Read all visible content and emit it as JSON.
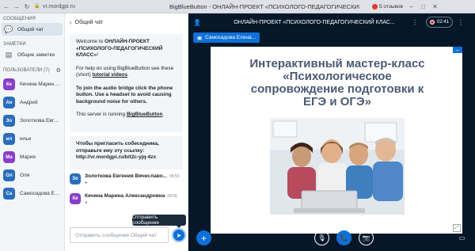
{
  "browser": {
    "url": "vr.mordgpi.ru",
    "window_title": "BigBlueButton - ОНЛАЙН-ПРОЕКТ «ПСИХОЛОГО-ПЕДАГОГИЧЕСКИЙ КЛАСС»",
    "badge": "5 отзывов"
  },
  "sidebar": {
    "messages_title": "СООБЩЕНИЯ",
    "public_chat": "Общий чат",
    "notes_title": "ЗАМЕТКИ",
    "shared_notes": "Общие заметки",
    "users_title": "ПОЛЬЗОВАТЕЛИ (7)",
    "users": [
      {
        "initials": "Ке",
        "name": "Кечина Марин...(Вы)",
        "color": "#8a3fc7"
      },
      {
        "initials": "Ан",
        "name": "Андрей",
        "color": "#2a6ebb"
      },
      {
        "initials": "Зо",
        "name": "Золоткова Евгени...",
        "color": "#2a6ebb"
      },
      {
        "initials": "ил",
        "name": "илья",
        "color": "#2a6ebb"
      },
      {
        "initials": "Ма",
        "name": "Мария",
        "color": "#8a3fc7"
      },
      {
        "initials": "Ол",
        "name": "Оля",
        "color": "#2a6ebb"
      },
      {
        "initials": "Са",
        "name": "Самосадова Елен...",
        "color": "#2a6ebb"
      }
    ]
  },
  "chat": {
    "title": "Общий чат",
    "welcome_prefix": "Welcome to ",
    "welcome_name": "ОНЛАЙН-ПРОЕКТ «ПСИХОЛОГО-ПЕДАГОГИЧЕСКИЙ КЛАСС»",
    "welcome_suffix": "!",
    "help_prefix": "For help on using BigBlueButton see these (short) ",
    "help_link": "tutorial videos",
    "help_suffix": ".",
    "audio_text": "To join the audio bridge click the phone button. Use a headset to avoid causing background noise for others.",
    "server_prefix": "This server is running ",
    "server_link": "BigBlueButton",
    "server_suffix": ".",
    "invite_text": "Чтобы пригласить собеседника, отправьте ему эту ссылку:",
    "invite_link": "http://vr.mordgpi.ru/b/t2c-yjq-4zx",
    "messages": [
      {
        "initials": "Зо",
        "name": "Золоткова Евгения Вячеславо...",
        "time": "08:55",
        "text": "+",
        "color": "#2a6ebb"
      },
      {
        "initials": "Ке",
        "name": "Кечина Марина Александровна",
        "time": "08:55",
        "text": "+",
        "color": "#8a3fc7"
      }
    ],
    "tooltip": "Отправить сообщение",
    "input_placeholder": "Отправить сообщение Общий чат"
  },
  "main": {
    "meeting_title": "ОНЛАЙН-ПРОЕКТ «ПСИХОЛОГО-ПЕДАГОГИЧЕСКИЙ КЛАС...",
    "recording_time": "02:41",
    "presenter": "Самосадова Елена...",
    "slide_title": "Интерактивный мастер-класс «Психологическое сопровождение подготовки к ЕГЭ и ОГЭ»"
  },
  "colors": {
    "accent": "#0f70d7",
    "dark_bg": "#06172a",
    "record": "#e03b2d"
  }
}
